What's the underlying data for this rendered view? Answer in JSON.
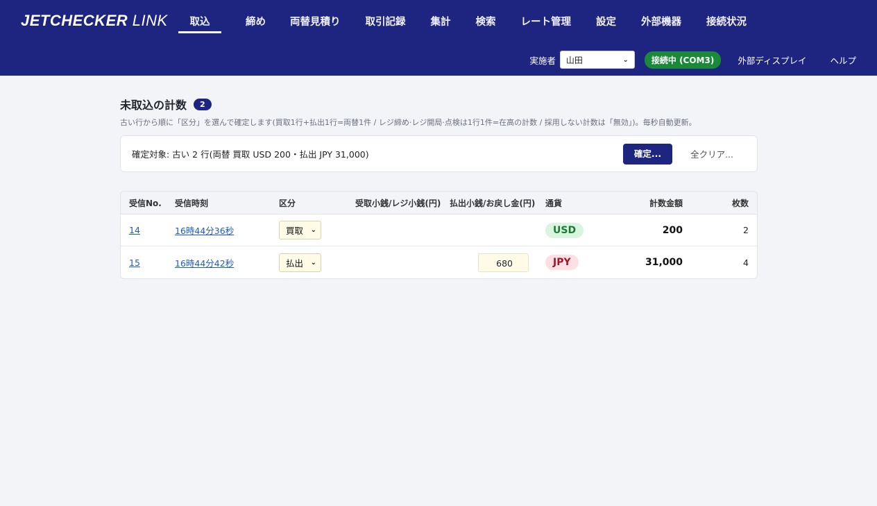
{
  "app": {
    "logo_bold": "JETCHECKER",
    "logo_light": " LINK"
  },
  "nav": [
    {
      "label": "取込",
      "active": true
    },
    {
      "label": "締め"
    },
    {
      "label": "両替見積り"
    },
    {
      "label": "取引記録"
    },
    {
      "label": "集計"
    },
    {
      "label": "検索"
    },
    {
      "label": "レート管理"
    },
    {
      "label": "設定"
    },
    {
      "label": "外部機器"
    },
    {
      "label": "接続状況"
    }
  ],
  "subbar": {
    "operator_label": "実施者",
    "operator_value": "山田",
    "status": "接続中 (COM3)",
    "external_display": "外部ディスプレイ",
    "help": "ヘルプ"
  },
  "page": {
    "title": "未取込の計数",
    "count": "2",
    "subtitle": "古い行から順に「区分」を選んで確定します(買取1行+払出1行=両替1件 / レジ締め·レジ開局·点検は1行1件=在高の計数 / 採用しない計数は「無効」)。毎秒自動更新。"
  },
  "confirm": {
    "text": "確定対象: 古い 2 行(両替 買取 USD 200・払出 JPY 31,000)",
    "confirm_button": "確定...",
    "clear_button": "全クリア..."
  },
  "table": {
    "headers": {
      "no": "受信No.",
      "time": "受信時刻",
      "kubun": "区分",
      "uke": "受取小銭/レジ小銭(円)",
      "hara": "払出小銭/お戻し金(円)",
      "currency": "通貨",
      "amount": "計数金額",
      "count": "枚数"
    },
    "rows": [
      {
        "no": "14",
        "time": "16時44分36秒",
        "kubun": "買取",
        "hara": "",
        "currency": "USD",
        "amount": "200",
        "count": "2"
      },
      {
        "no": "15",
        "time": "16時44分42秒",
        "kubun": "払出",
        "hara": "680",
        "currency": "JPY",
        "amount": "31,000",
        "count": "4"
      }
    ]
  },
  "colors": {
    "brand": "#1e2580",
    "status_ok": "#1a8a3a"
  }
}
